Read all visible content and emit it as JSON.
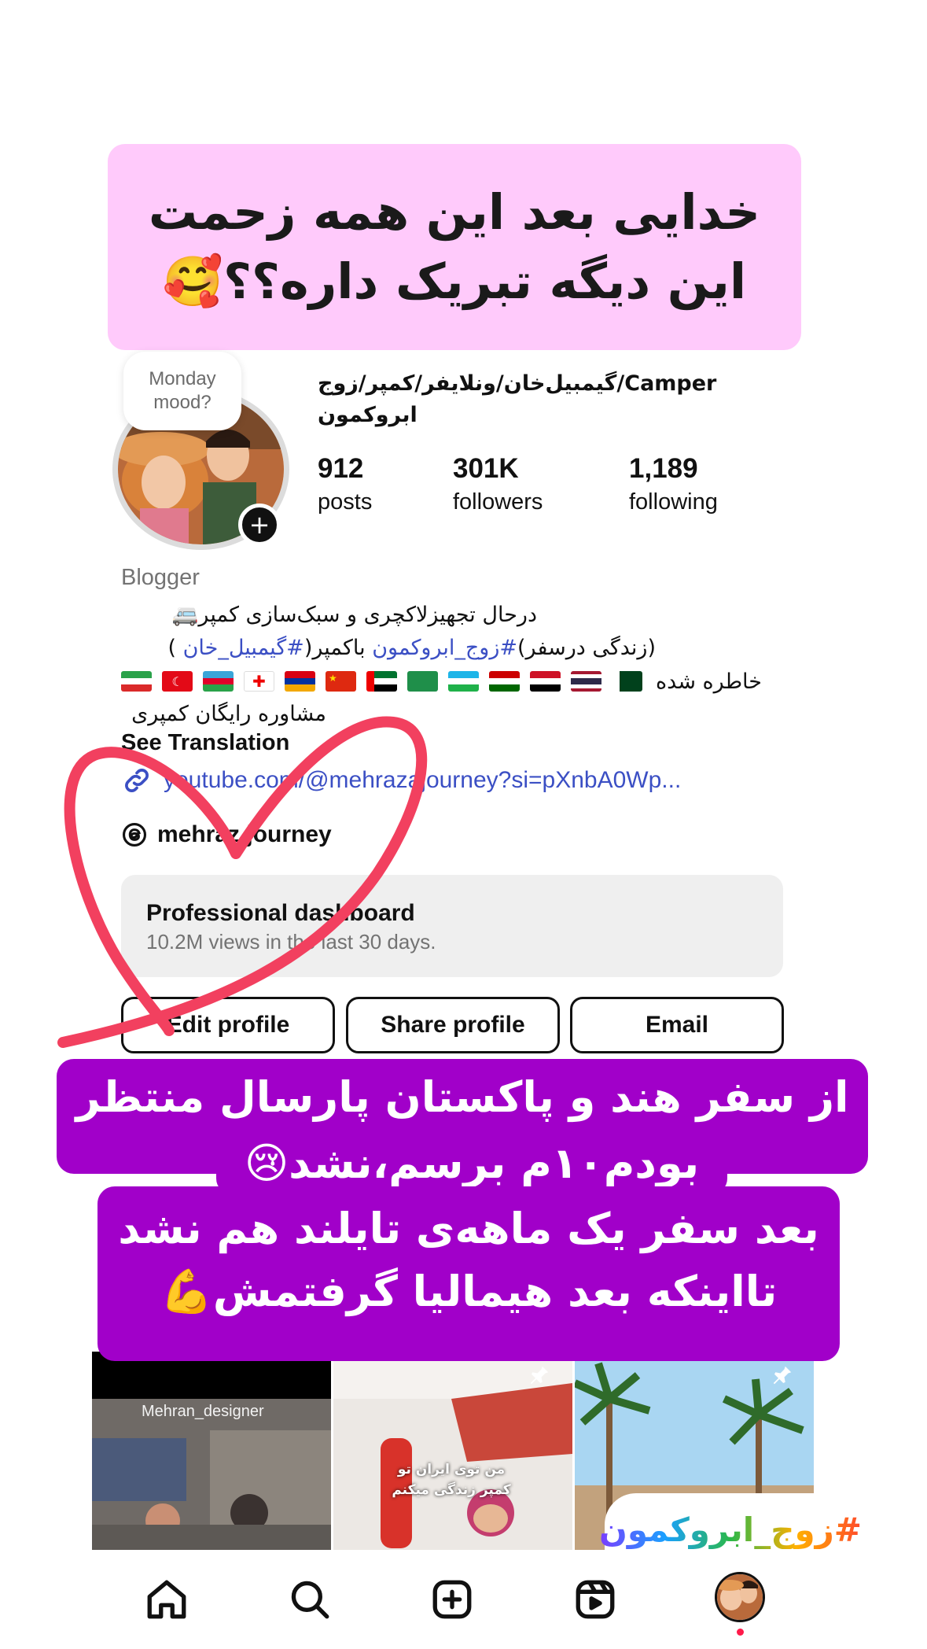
{
  "top_caption": {
    "line1": "خدایی بعد این همه زحمت",
    "line2": "این دیگه تبریک داره؟؟🥰"
  },
  "note": {
    "line1": "Monday",
    "line2": "mood?"
  },
  "profile": {
    "name": "گیمبیل‌خان/ونلایفر/کمپر/زوج/Camper ابروکمون",
    "stats": {
      "posts": {
        "value": "912",
        "label": "posts"
      },
      "followers": {
        "value": "301K",
        "label": "followers"
      },
      "following": {
        "value": "1,189",
        "label": "following"
      }
    }
  },
  "bio": {
    "category": "Blogger",
    "line1": "درحال تجهیزلاکچری و سبک‌سازی کمپر🚐",
    "line2_prefix": "(زندگی درسفر)",
    "line2_tag1": "#زوج_ابروکمون",
    "line2_mid": " باکمپر(",
    "line2_tag2": "#گیمبیل_خان",
    "line2_suffix": " )",
    "flags_label": "خاطره شده",
    "line4": "مشاوره رایگان کمپری",
    "see_translation": "See Translation",
    "link": "youtube.com/@mehrazajourney?si=pXnbA0Wp...",
    "threads": "mehraz.journey"
  },
  "pro_dashboard": {
    "title": "Professional dashboard",
    "subtitle": "10.2M views in the last 30 days."
  },
  "buttons": {
    "edit": "Edit profile",
    "share": "Share profile",
    "email": "Email"
  },
  "purple_caption_1": {
    "line1": "از سفر هند و پاکستان پارسال منتظر",
    "line2": "بودم۱۰م برسم،نشد😢"
  },
  "purple_caption_2": {
    "line1": "بعد سفر یک ماهه‌ی تایلند هم نشد",
    "line2": "تااینکه بعد هیمالیا گرفتمش💪"
  },
  "posts": {
    "p1_caption": "Mehran_designer",
    "p2_caption": "من توی ایران تو کمپر زندگی میکنم"
  },
  "hashtag_sticker": "#زوج_ابروکمون",
  "colors": {
    "pink_caption": "#ffcafb",
    "purple_caption": "#a100c9",
    "link": "#3b4fc4",
    "heart": "#f2405f"
  },
  "nav": [
    "home-icon",
    "search-icon",
    "create-icon",
    "reels-icon",
    "profile-avatar"
  ]
}
